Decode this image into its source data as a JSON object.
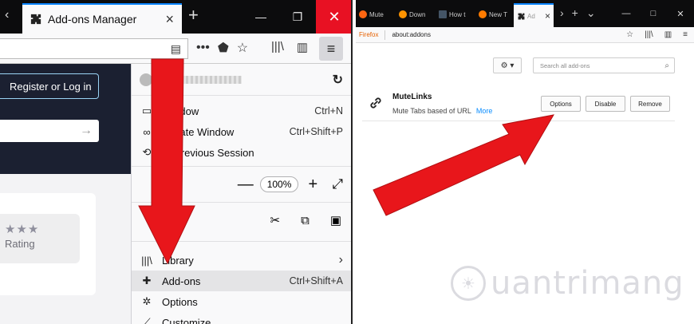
{
  "left": {
    "tab": {
      "title": "Add-ons Manager",
      "close": "×"
    },
    "new_tab": "+",
    "window_controls": {
      "minimize": "—",
      "maximize": "❐",
      "close": "✕"
    },
    "toolbar": {
      "reader": "▤",
      "more": "•••",
      "pocket": "⬟",
      "star": "☆",
      "library": "|||\\",
      "sidebar": "▥",
      "menu": "≡"
    },
    "page": {
      "register_label": "Register or Log in",
      "search_arrow": "→",
      "stars": "★★★",
      "rating_label": "Rating"
    },
    "menu": {
      "sync_icon": "↻",
      "items": [
        {
          "icon": "▭",
          "label": "Window",
          "shortcut": "Ctrl+N"
        },
        {
          "icon": "∞",
          "label": "Private Window",
          "shortcut": "Ctrl+Shift+P"
        },
        {
          "icon": "⟲",
          "label": "re Previous Session",
          "shortcut": ""
        }
      ],
      "zoom": {
        "label": "n",
        "minus": "—",
        "value": "100%",
        "plus": "+",
        "fullscreen": "⤢"
      },
      "edit": {
        "cut": "✂",
        "copy": "⧉",
        "paste": "▣"
      },
      "lower_items": [
        {
          "icon": "|||\\",
          "label": "Library",
          "shortcut": "›"
        },
        {
          "icon": "✚",
          "label": "Add-ons",
          "shortcut": "Ctrl+Shift+A"
        },
        {
          "icon": "✲",
          "label": "Options",
          "shortcut": ""
        },
        {
          "icon": "⟋",
          "label": "Customize...",
          "shortcut": ""
        }
      ]
    }
  },
  "right": {
    "tabs": [
      {
        "label": "Mute",
        "color": "#ff6611"
      },
      {
        "label": "Down",
        "color": "#ff9400"
      },
      {
        "label": "How t",
        "color": "#445566"
      },
      {
        "label": "New T",
        "color": "#ff7b00"
      }
    ],
    "active_tab": {
      "label": "Ad",
      "close": "×"
    },
    "tab_controls": {
      "scroll": "›",
      "new_tab": "+",
      "list": "⌄"
    },
    "window_controls": {
      "minimize": "—",
      "maximize": "□",
      "close": "✕"
    },
    "urlbar": {
      "brand": "Firefox",
      "url": "about:addons",
      "star": "☆",
      "library": "|||\\",
      "sidebar": "▥",
      "menu": "≡"
    },
    "tools_button": "⚙ ▾",
    "search_placeholder": "Search all add-ons",
    "search_icon": "⌕",
    "addon": {
      "name": "MuteLinks",
      "description": "Mute Tabs based of URL",
      "more": "More",
      "buttons": {
        "options": "Options",
        "disable": "Disable",
        "remove": "Remove"
      }
    },
    "watermark": {
      "text": "uantrimang",
      "icon": "☀"
    }
  },
  "colors": {
    "arrow": "#e8161b",
    "tab_accent": "#0a84ff",
    "dark_bg": "#0c0c0d",
    "page_dark": "#1b2031",
    "link": "#0a8dff"
  }
}
